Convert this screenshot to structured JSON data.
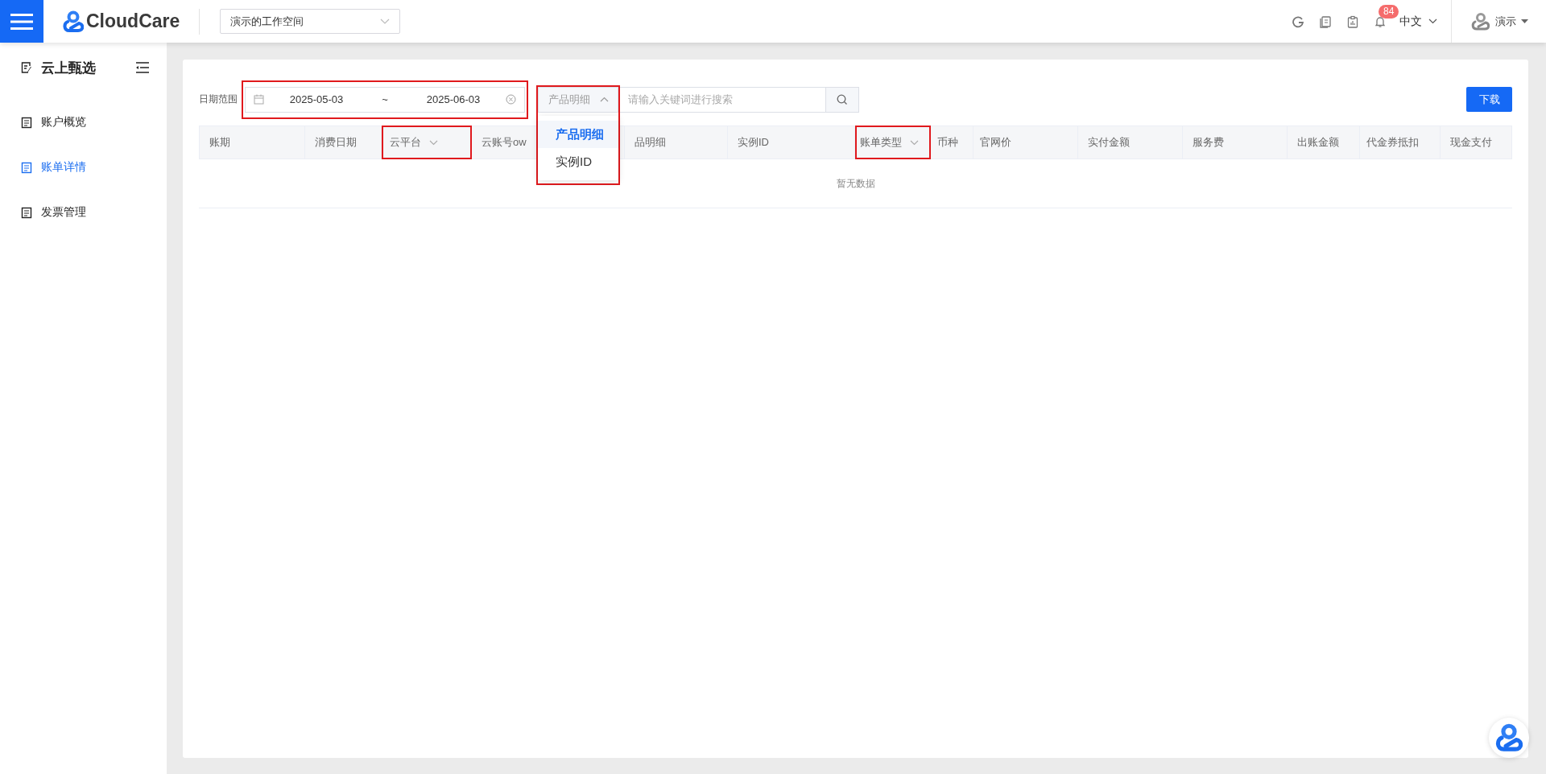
{
  "topbar": {
    "logo": "CloudCare",
    "workspace": "演示的工作空间",
    "notification_count": "84",
    "language": "中文",
    "user": "演示"
  },
  "sidebar": {
    "title": "云上甄选",
    "items": [
      {
        "label": "账户概览",
        "selected": false
      },
      {
        "label": "账单详情",
        "selected": true
      },
      {
        "label": "发票管理",
        "selected": false
      }
    ]
  },
  "filters": {
    "date_label": "日期范围",
    "date_range": {
      "start": "2025-05-03",
      "separator": "~",
      "end": "2025-06-03",
      "highlighted": true
    },
    "search_type": {
      "value": "产品明细",
      "expanded": true,
      "highlighted": true,
      "options": [
        {
          "label": "产品明细",
          "selected": true
        },
        {
          "label": "实例ID",
          "selected": false
        }
      ]
    },
    "search": {
      "placeholder": "请输入关键词进行搜索"
    },
    "download_button": "下载"
  },
  "table": {
    "columns": [
      {
        "label": "账期",
        "dropdown": false,
        "highlighted": false
      },
      {
        "label": "消费日期",
        "dropdown": false,
        "highlighted": false
      },
      {
        "label": "云平台",
        "dropdown": true,
        "highlighted": true
      },
      {
        "label": "云账号ow",
        "dropdown": false,
        "highlighted": false
      },
      {
        "label": "品明细",
        "dropdown": false,
        "highlighted": false
      },
      {
        "label": "实例ID",
        "dropdown": false,
        "highlighted": false
      },
      {
        "label": "账单类型",
        "dropdown": true,
        "highlighted": true
      },
      {
        "label": "币种",
        "dropdown": false,
        "highlighted": false
      },
      {
        "label": "官网价",
        "dropdown": false,
        "highlighted": false
      },
      {
        "label": "实付金额",
        "dropdown": false,
        "highlighted": false
      },
      {
        "label": "服务费",
        "dropdown": false,
        "highlighted": false
      },
      {
        "label": "出账金额",
        "dropdown": false,
        "highlighted": false
      },
      {
        "label": "代金券抵扣",
        "dropdown": false,
        "highlighted": false
      },
      {
        "label": "现金支付",
        "dropdown": false,
        "highlighted": false
      }
    ],
    "empty_text": "暂无数据"
  }
}
